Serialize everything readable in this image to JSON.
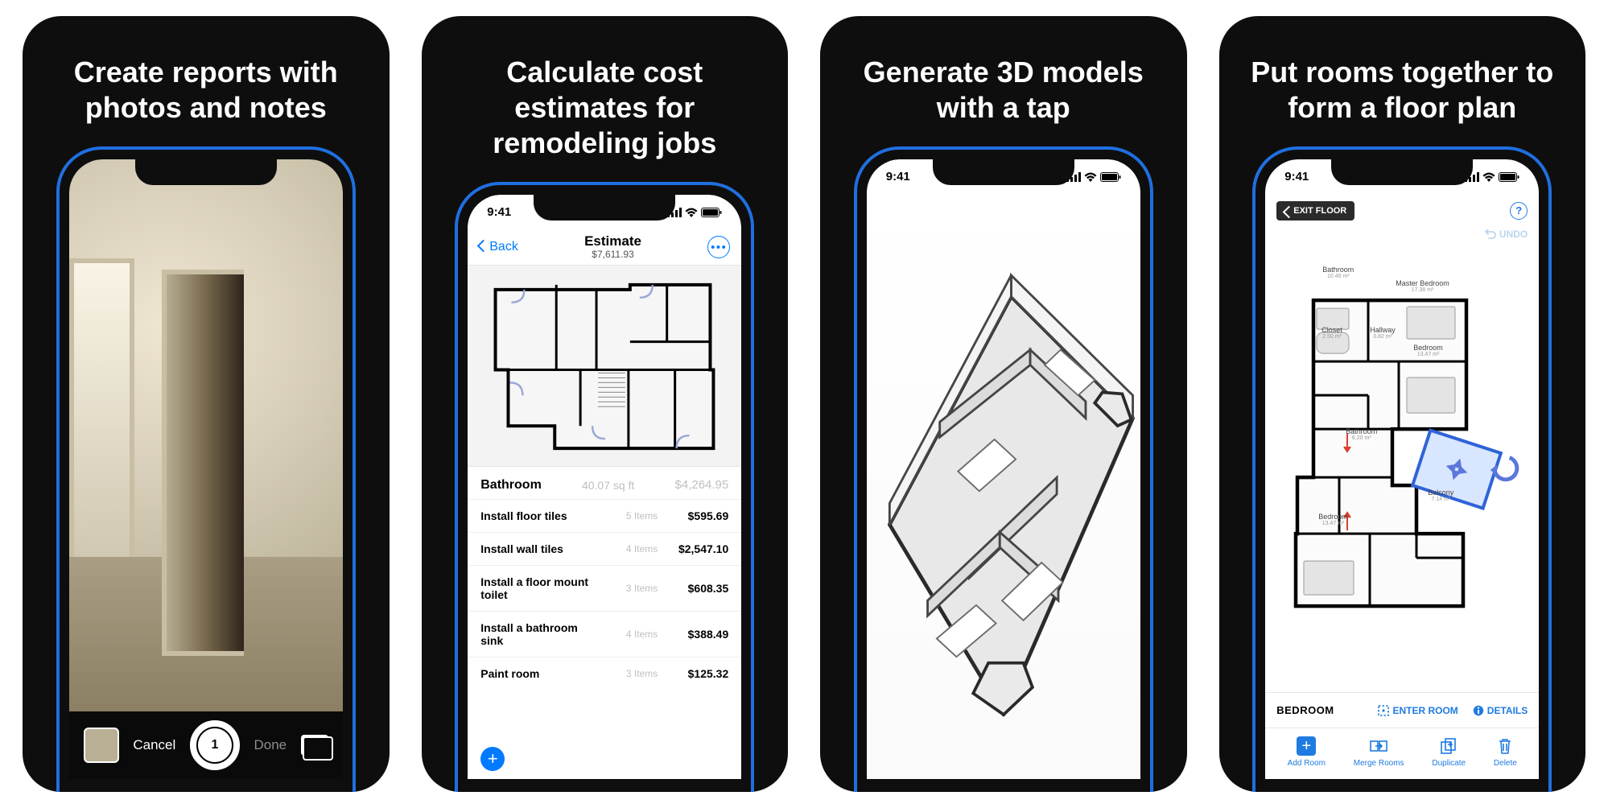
{
  "cards": [
    {
      "headline": "Create reports with photos and notes",
      "camera_bar": {
        "cancel": "Cancel",
        "count": "1",
        "done": "Done"
      }
    },
    {
      "headline": "Calculate cost estimates for remodeling jobs",
      "status_time": "9:41",
      "nav": {
        "back": "Back",
        "title": "Estimate",
        "subtitle": "$7,611.93"
      },
      "section": {
        "name": "Bathroom",
        "area": "40.07 sq ft",
        "cost": "$4,264.95"
      },
      "rows": [
        {
          "label": "Install floor tiles",
          "items": "5 Items",
          "cost": "$595.69"
        },
        {
          "label": "Install wall tiles",
          "items": "4 Items",
          "cost": "$2,547.10"
        },
        {
          "label": "Install a floor mount toilet",
          "items": "3 Items",
          "cost": "$608.35"
        },
        {
          "label": "Install a bathroom sink",
          "items": "4 Items",
          "cost": "$388.49"
        },
        {
          "label": "Paint room",
          "items": "3 Items",
          "cost": "$125.32"
        }
      ]
    },
    {
      "headline": "Generate 3D models with a tap",
      "status_time": "9:41"
    },
    {
      "headline": "Put rooms together to form a floor plan",
      "status_time": "9:41",
      "exit_label": "EXIT FLOOR",
      "undo_label": "UNDO",
      "rooms": [
        {
          "name": "Bathroom",
          "area": "10.46 m²"
        },
        {
          "name": "Master Bedroom",
          "area": "17.38 m²"
        },
        {
          "name": "Closet",
          "area": "2.50 m²"
        },
        {
          "name": "Hallway",
          "area": "3.82 m²"
        },
        {
          "name": "Bedroom",
          "area": "13.47 m²"
        },
        {
          "name": "Bathroom",
          "area": "6.20 m²"
        },
        {
          "name": "Balcony",
          "area": "7.14 m²"
        },
        {
          "name": "Bedroom",
          "area": "13.47 m²"
        }
      ],
      "selected_room": "BEDROOM",
      "selected_actions": {
        "enter": "ENTER ROOM",
        "details": "DETAILS"
      },
      "toolbar": {
        "add": "Add Room",
        "merge": "Merge Rooms",
        "dup": "Duplicate",
        "del": "Delete"
      }
    }
  ]
}
